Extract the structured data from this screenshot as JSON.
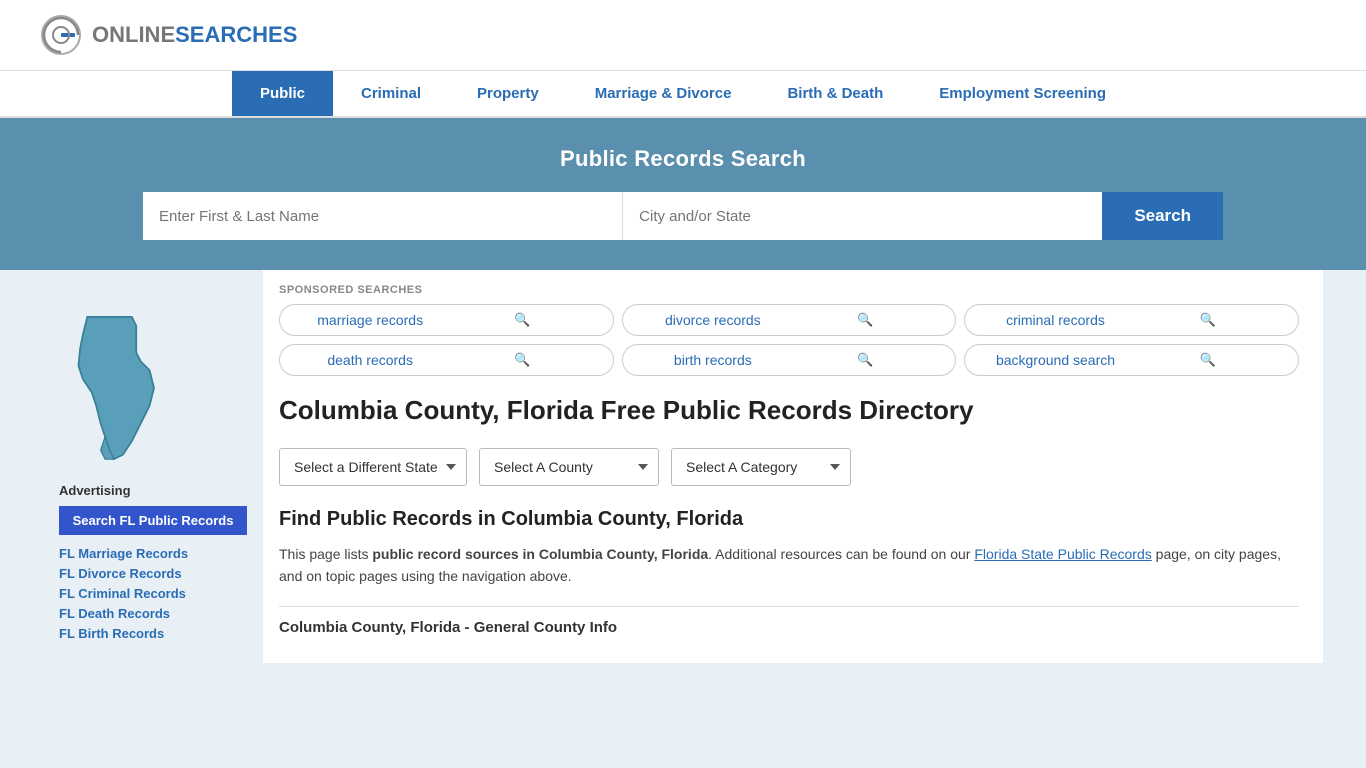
{
  "site": {
    "logo_text_normal": "ONLINE",
    "logo_text_bold": "SEARCHES"
  },
  "nav": {
    "items": [
      {
        "label": "Public",
        "active": true
      },
      {
        "label": "Criminal",
        "active": false
      },
      {
        "label": "Property",
        "active": false
      },
      {
        "label": "Marriage & Divorce",
        "active": false
      },
      {
        "label": "Birth & Death",
        "active": false
      },
      {
        "label": "Employment Screening",
        "active": false
      }
    ]
  },
  "hero": {
    "title": "Public Records Search",
    "name_placeholder": "Enter First & Last Name",
    "location_placeholder": "City and/or State",
    "search_label": "Search"
  },
  "sponsored": {
    "label": "SPONSORED SEARCHES",
    "pills": [
      {
        "text": "marriage records"
      },
      {
        "text": "divorce records"
      },
      {
        "text": "criminal records"
      },
      {
        "text": "death records"
      },
      {
        "text": "birth records"
      },
      {
        "text": "background search"
      }
    ]
  },
  "county": {
    "heading": "Columbia County, Florida Free Public Records Directory"
  },
  "dropdowns": {
    "state_label": "Select a Different State",
    "county_label": "Select A County",
    "category_label": "Select A Category"
  },
  "content": {
    "find_title": "Find Public Records in Columbia County, Florida",
    "find_desc_1": "This page lists ",
    "find_desc_bold": "public record sources in Columbia County, Florida",
    "find_desc_2": ". Additional resources can be found on our ",
    "find_link_text": "Florida State Public Records",
    "find_desc_3": " page, on city pages, and on topic pages using the navigation above.",
    "general_info": "Columbia County, Florida - General County Info"
  },
  "sidebar": {
    "advertising_label": "Advertising",
    "ad_button": "Search FL Public Records",
    "links": [
      {
        "text": "FL Marriage Records"
      },
      {
        "text": "FL Divorce Records"
      },
      {
        "text": "FL Criminal Records"
      },
      {
        "text": "FL Death Records"
      },
      {
        "text": "FL Birth Records"
      }
    ]
  }
}
